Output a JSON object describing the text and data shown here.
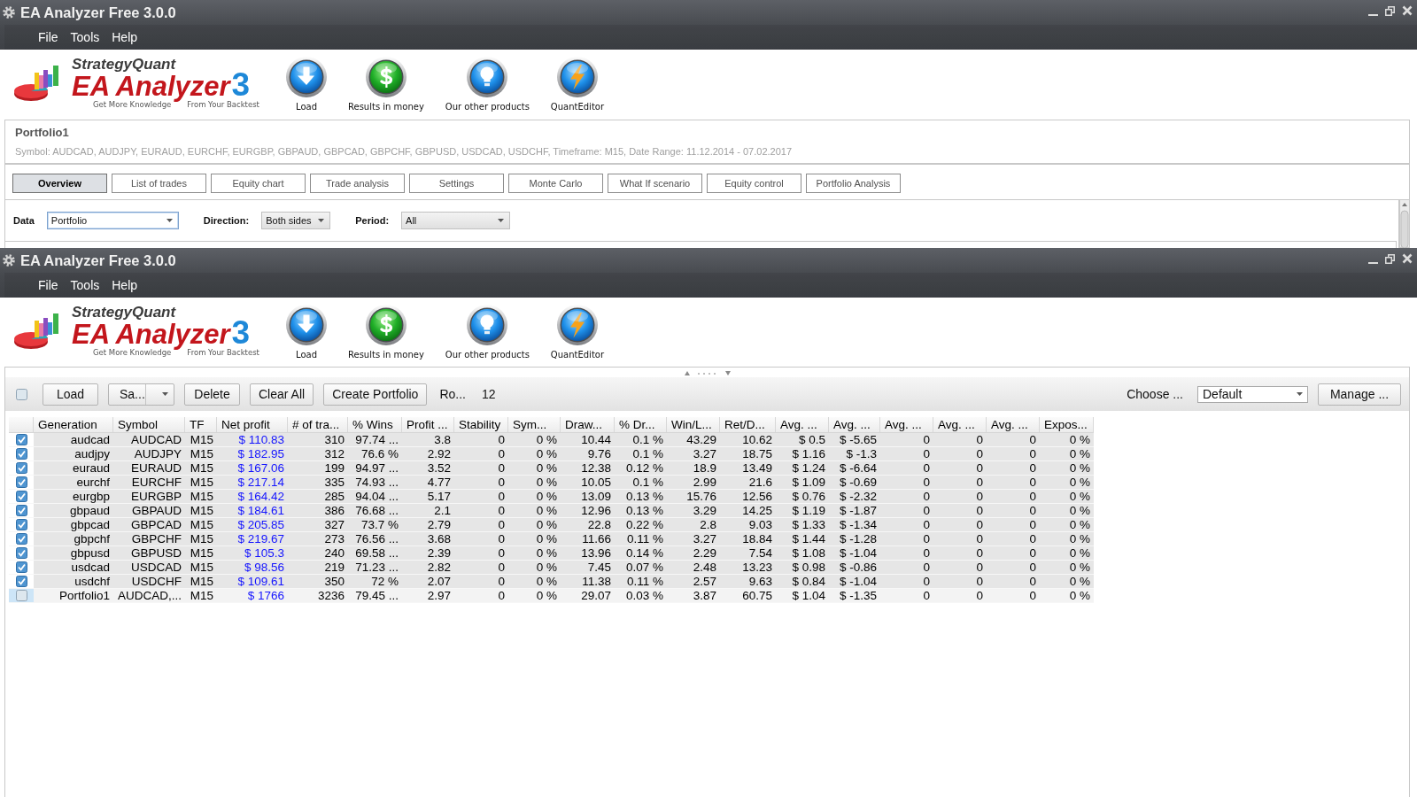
{
  "windows": [
    {
      "title": "EA Analyzer Free 3.0.0",
      "menu": [
        "File",
        "Tools",
        "Help"
      ],
      "logo": {
        "brand": "StrategyQuant",
        "product": "EA Analyzer",
        "version": "3",
        "slogan": [
          "Get More Knowledge",
          "From Your Backtest"
        ]
      },
      "tools": [
        {
          "kind": "load",
          "label": "Load"
        },
        {
          "kind": "money",
          "label": "Results in money"
        },
        {
          "kind": "products",
          "label": "Our other products"
        },
        {
          "kind": "editor",
          "label": "QuantEditor"
        }
      ],
      "portfolio": {
        "name": "Portfolio1",
        "summary": "Symbol: AUDCAD, AUDJPY, EURAUD, EURCHF, EURGBP, GBPAUD, GBPCAD, GBPCHF, GBPUSD, USDCAD, USDCHF, Timeframe: M15, Date Range: 11.12.2014 - 07.02.2017"
      },
      "tabs": [
        {
          "label": "Overview",
          "selected": true
        },
        {
          "label": "List of trades",
          "selected": false
        },
        {
          "label": "Equity chart",
          "selected": false
        },
        {
          "label": "Trade analysis",
          "selected": false
        },
        {
          "label": "Settings",
          "selected": false
        },
        {
          "label": "Monte Carlo",
          "selected": false
        },
        {
          "label": "What If scenario",
          "selected": false
        },
        {
          "label": "Equity control",
          "selected": false
        },
        {
          "label": "Portfolio Analysis",
          "selected": false
        }
      ],
      "filters": [
        {
          "label": "Data",
          "value": "Portfolio",
          "focused": true
        },
        {
          "label": "Direction:",
          "value": "Both sides",
          "focused": false
        },
        {
          "label": "Period:",
          "value": "All",
          "focused": false
        }
      ]
    },
    {
      "title": "EA Analyzer Free 3.0.0",
      "menu": [
        "File",
        "Tools",
        "Help"
      ],
      "logo": {
        "brand": "StrategyQuant",
        "product": "EA Analyzer",
        "version": "3",
        "slogan": [
          "Get More Knowledge",
          "From Your Backtest"
        ]
      },
      "tools": [
        {
          "kind": "load",
          "label": "Load"
        },
        {
          "kind": "money",
          "label": "Results in money"
        },
        {
          "kind": "products",
          "label": "Our other products"
        },
        {
          "kind": "editor",
          "label": "QuantEditor"
        }
      ],
      "databank": {
        "all_checked": false,
        "actions": [
          {
            "kind": "button",
            "label": "Load"
          },
          {
            "kind": "split",
            "label": "Sa..."
          },
          {
            "kind": "button",
            "label": "Delete"
          },
          {
            "kind": "button",
            "label": "Clear All"
          },
          {
            "kind": "button",
            "label": "Create Portfolio"
          }
        ],
        "rows_label": "Ro...",
        "rows_count": "12",
        "choose_label": "Choose ...",
        "choose_value": "Default",
        "manage": "Manage ..."
      },
      "table": {
        "columns": [
          {
            "label": "Generation",
            "kind": "plain"
          },
          {
            "label": "Symbol",
            "kind": "plain"
          },
          {
            "label": "TF",
            "kind": "plain"
          },
          {
            "label": "Net profit",
            "kind": "money"
          },
          {
            "label": "# of tra...",
            "kind": "plain"
          },
          {
            "label": "% Wins",
            "kind": "plain"
          },
          {
            "label": "Profit ...",
            "kind": "plain"
          },
          {
            "label": "Stability",
            "kind": "plain"
          },
          {
            "label": "Sym...",
            "kind": "plain"
          },
          {
            "label": "Draw...",
            "kind": "plain"
          },
          {
            "label": "% Dr...",
            "kind": "plain"
          },
          {
            "label": "Win/L...",
            "kind": "plain"
          },
          {
            "label": "Ret/D...",
            "kind": "plain"
          },
          {
            "label": "Avg. ...",
            "kind": "plain"
          },
          {
            "label": "Avg. ...",
            "kind": "plain"
          },
          {
            "label": "Avg. ...",
            "kind": "plain"
          },
          {
            "label": "Avg. ...",
            "kind": "plain"
          },
          {
            "label": "Avg. ...",
            "kind": "plain"
          },
          {
            "label": "Expos...",
            "kind": "plain"
          }
        ],
        "rows": [
          {
            "checked": true,
            "selected": false,
            "cells": [
              "audcad",
              "AUDCAD",
              "M15",
              "$ 110.83",
              "310",
              "97.74 ...",
              "3.8",
              "0",
              "0 %",
              "10.44",
              "0.1 %",
              "43.29",
              "10.62",
              "$ 0.5",
              "$ -5.65",
              "0",
              "0",
              "0",
              "0 %"
            ]
          },
          {
            "checked": true,
            "selected": false,
            "cells": [
              "audjpy",
              "AUDJPY",
              "M15",
              "$ 182.95",
              "312",
              "76.6 %",
              "2.92",
              "0",
              "0 %",
              "9.76",
              "0.1 %",
              "3.27",
              "18.75",
              "$ 1.16",
              "$ -1.3",
              "0",
              "0",
              "0",
              "0 %"
            ]
          },
          {
            "checked": true,
            "selected": false,
            "cells": [
              "euraud",
              "EURAUD",
              "M15",
              "$ 167.06",
              "199",
              "94.97 ...",
              "3.52",
              "0",
              "0 %",
              "12.38",
              "0.12 %",
              "18.9",
              "13.49",
              "$ 1.24",
              "$ -6.64",
              "0",
              "0",
              "0",
              "0 %"
            ]
          },
          {
            "checked": true,
            "selected": false,
            "cells": [
              "eurchf",
              "EURCHF",
              "M15",
              "$ 217.14",
              "335",
              "74.93 ...",
              "4.77",
              "0",
              "0 %",
              "10.05",
              "0.1 %",
              "2.99",
              "21.6",
              "$ 1.09",
              "$ -0.69",
              "0",
              "0",
              "0",
              "0 %"
            ]
          },
          {
            "checked": true,
            "selected": false,
            "cells": [
              "eurgbp",
              "EURGBP",
              "M15",
              "$ 164.42",
              "285",
              "94.04 ...",
              "5.17",
              "0",
              "0 %",
              "13.09",
              "0.13 %",
              "15.76",
              "12.56",
              "$ 0.76",
              "$ -2.32",
              "0",
              "0",
              "0",
              "0 %"
            ]
          },
          {
            "checked": true,
            "selected": false,
            "cells": [
              "gbpaud",
              "GBPAUD",
              "M15",
              "$ 184.61",
              "386",
              "76.68 ...",
              "2.1",
              "0",
              "0 %",
              "12.96",
              "0.13 %",
              "3.29",
              "14.25",
              "$ 1.19",
              "$ -1.87",
              "0",
              "0",
              "0",
              "0 %"
            ]
          },
          {
            "checked": true,
            "selected": false,
            "cells": [
              "gbpcad",
              "GBPCAD",
              "M15",
              "$ 205.85",
              "327",
              "73.7 %",
              "2.79",
              "0",
              "0 %",
              "22.8",
              "0.22 %",
              "2.8",
              "9.03",
              "$ 1.33",
              "$ -1.34",
              "0",
              "0",
              "0",
              "0 %"
            ]
          },
          {
            "checked": true,
            "selected": false,
            "cells": [
              "gbpchf",
              "GBPCHF",
              "M15",
              "$ 219.67",
              "273",
              "76.56 ...",
              "3.68",
              "0",
              "0 %",
              "11.66",
              "0.11 %",
              "3.27",
              "18.84",
              "$ 1.44",
              "$ -1.28",
              "0",
              "0",
              "0",
              "0 %"
            ]
          },
          {
            "checked": true,
            "selected": false,
            "cells": [
              "gbpusd",
              "GBPUSD",
              "M15",
              "$ 105.3",
              "240",
              "69.58 ...",
              "2.39",
              "0",
              "0 %",
              "13.96",
              "0.14 %",
              "2.29",
              "7.54",
              "$ 1.08",
              "$ -1.04",
              "0",
              "0",
              "0",
              "0 %"
            ]
          },
          {
            "checked": true,
            "selected": false,
            "cells": [
              "usdcad",
              "USDCAD",
              "M15",
              "$ 98.56",
              "219",
              "71.23 ...",
              "2.82",
              "0",
              "0 %",
              "7.45",
              "0.07 %",
              "2.48",
              "13.23",
              "$ 0.98",
              "$ -0.86",
              "0",
              "0",
              "0",
              "0 %"
            ]
          },
          {
            "checked": true,
            "selected": false,
            "cells": [
              "usdchf",
              "USDCHF",
              "M15",
              "$ 109.61",
              "350",
              "72 %",
              "2.07",
              "0",
              "0 %",
              "11.38",
              "0.11 %",
              "2.57",
              "9.63",
              "$ 0.84",
              "$ -1.04",
              "0",
              "0",
              "0",
              "0 %"
            ]
          },
          {
            "checked": false,
            "selected": true,
            "cells": [
              "Portfolio1",
              "AUDCAD,...",
              "M15",
              "$ 1766",
              "3236",
              "79.45 ...",
              "2.97",
              "0",
              "0 %",
              "29.07",
              "0.03 %",
              "3.87",
              "60.75",
              "$ 1.04",
              "$ -1.35",
              "0",
              "0",
              "0",
              "0 %"
            ]
          }
        ]
      }
    }
  ]
}
